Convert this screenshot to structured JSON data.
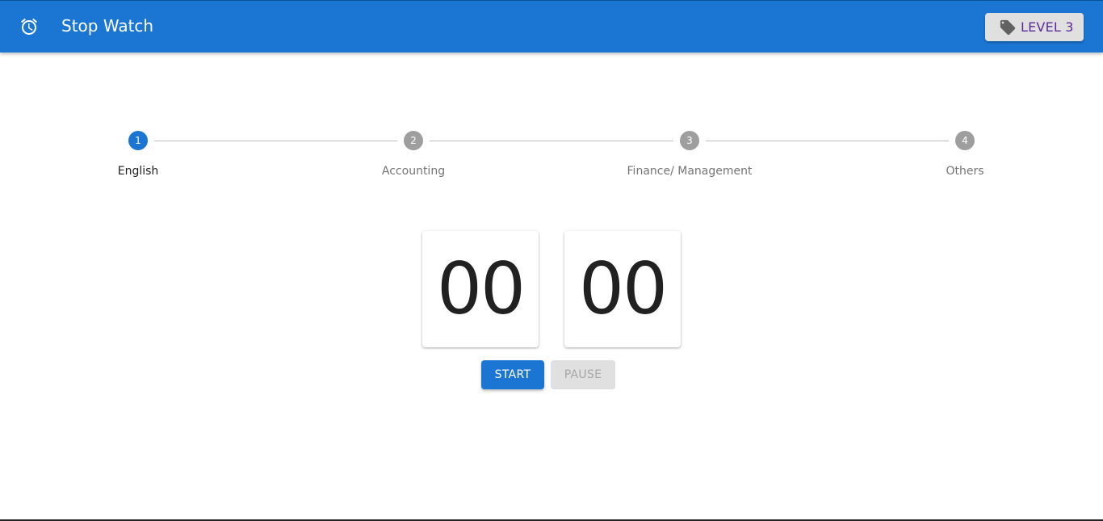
{
  "appbar": {
    "title": "Stop Watch",
    "level_label": "LEVEL 3",
    "alarm_icon": "alarm-clock-icon",
    "tag_icon": "tag-icon"
  },
  "stepper": {
    "steps": [
      {
        "number": "1",
        "label": "English",
        "active": true
      },
      {
        "number": "2",
        "label": "Accounting",
        "active": false
      },
      {
        "number": "3",
        "label": "Finance/ Management",
        "active": false
      },
      {
        "number": "4",
        "label": "Others",
        "active": false
      }
    ]
  },
  "timer": {
    "minutes": "00",
    "seconds": "00"
  },
  "controls": {
    "start_label": "START",
    "pause_label": "PAUSE",
    "pause_disabled": true
  },
  "colors": {
    "primary": "#1b76d3",
    "inactive_step": "#9e9e9e",
    "level_text": "#5b2a96"
  }
}
